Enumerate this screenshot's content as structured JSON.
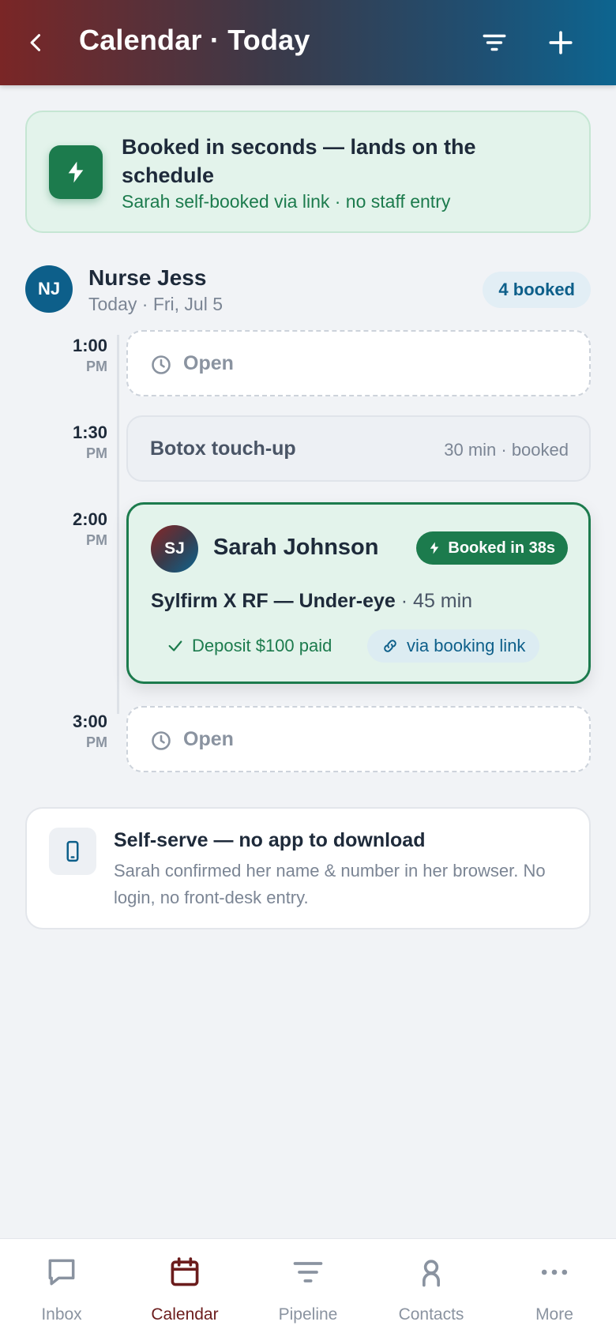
{
  "header": {
    "title": "Calendar · Today"
  },
  "banner": {
    "title": "Booked in seconds — lands on the schedule",
    "subtitle": "Sarah self-booked via link · no staff entry"
  },
  "provider": {
    "initials": "NJ",
    "name": "Nurse Jess",
    "date": "Today · Fri, Jul 5",
    "badge": "4 booked"
  },
  "times": [
    {
      "hm": "1:00",
      "ap": "PM"
    },
    {
      "hm": "1:30",
      "ap": "PM"
    },
    {
      "hm": "2:00",
      "ap": "PM"
    },
    {
      "hm": "3:00",
      "ap": "PM"
    }
  ],
  "slots": {
    "open_label": "Open",
    "booked_service": "Botox touch-up",
    "booked_meta": "30 min · booked"
  },
  "appointment": {
    "initials": "SJ",
    "name": "Sarah Johnson",
    "badge": "Booked in 38s",
    "service": "Sylfirm X RF — Under-eye",
    "duration": "· 45 min",
    "deposit": "Deposit $100 paid",
    "source": "via booking link"
  },
  "info": {
    "title": "Self-serve — no app to download",
    "body": "Sarah confirmed her name & number in her browser. No login, no front-desk entry."
  },
  "tabs": [
    {
      "label": "Inbox",
      "icon": "chat-icon"
    },
    {
      "label": "Calendar",
      "icon": "calendar-icon"
    },
    {
      "label": "Pipeline",
      "icon": "pipeline-icon"
    },
    {
      "label": "Contacts",
      "icon": "person-icon"
    },
    {
      "label": "More",
      "icon": "more-icon"
    }
  ],
  "colors": {
    "brand_green": "#1c7b4d",
    "brand_blue": "#0d5f8a",
    "active_tab": "#6b1c1c"
  }
}
